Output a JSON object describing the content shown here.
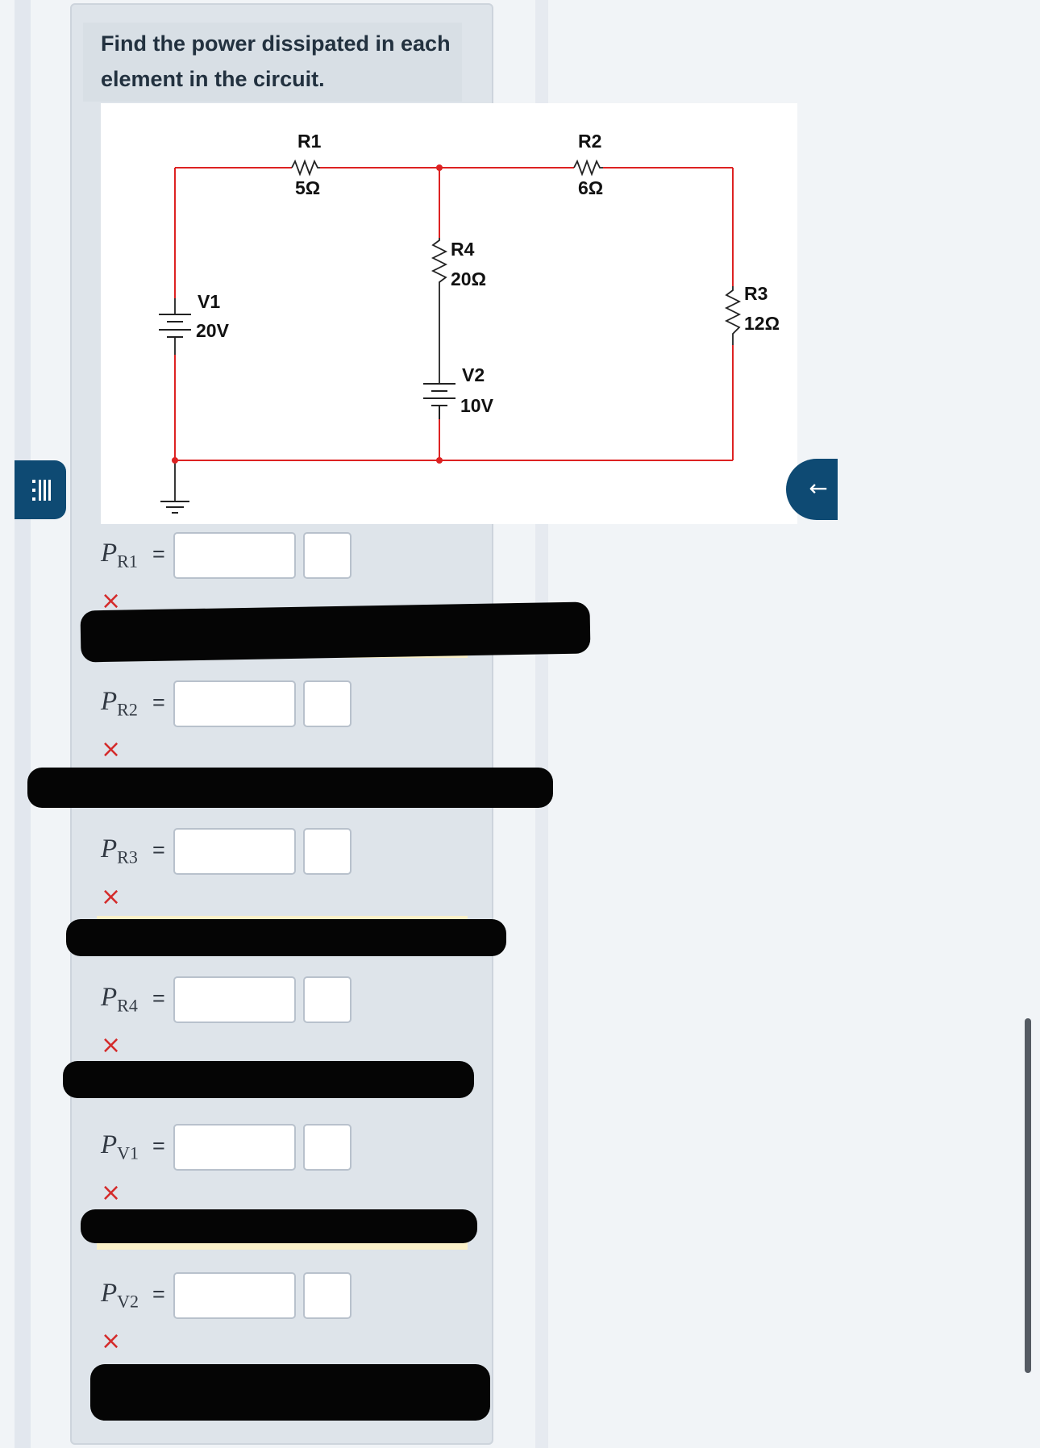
{
  "question": {
    "text": "Find the power dissipated in each element in the circuit."
  },
  "circuit": {
    "wire_color": "#dd2222",
    "components": {
      "R1": {
        "name": "R1",
        "value": "5Ω"
      },
      "R2": {
        "name": "R2",
        "value": "6Ω"
      },
      "R3": {
        "name": "R3",
        "value": "12Ω"
      },
      "R4": {
        "name": "R4",
        "value": "20Ω"
      },
      "V1": {
        "name": "V1",
        "value": "20V"
      },
      "V2": {
        "name": "V2",
        "value": "10V"
      }
    }
  },
  "answers": [
    {
      "symbol": "P",
      "sub": "R1",
      "equals": "=",
      "value": "",
      "unit": "",
      "status": "×"
    },
    {
      "symbol": "P",
      "sub": "R2",
      "equals": "=",
      "value": "",
      "unit": "",
      "status": "×"
    },
    {
      "symbol": "P",
      "sub": "R3",
      "equals": "=",
      "value": "",
      "unit": "",
      "status": "×"
    },
    {
      "symbol": "P",
      "sub": "R4",
      "equals": "=",
      "value": "",
      "unit": "",
      "status": "×"
    },
    {
      "symbol": "P",
      "sub": "V1",
      "equals": "=",
      "value": "",
      "unit": "",
      "status": "×"
    },
    {
      "symbol": "P",
      "sub": "V2",
      "equals": "=",
      "value": "",
      "unit": "",
      "status": "×"
    }
  ],
  "navigation": {
    "menu_icon": "list-icon",
    "back_icon": "arrow-left-icon",
    "back_glyph": "←",
    "accent_color": "#0e4a73"
  }
}
